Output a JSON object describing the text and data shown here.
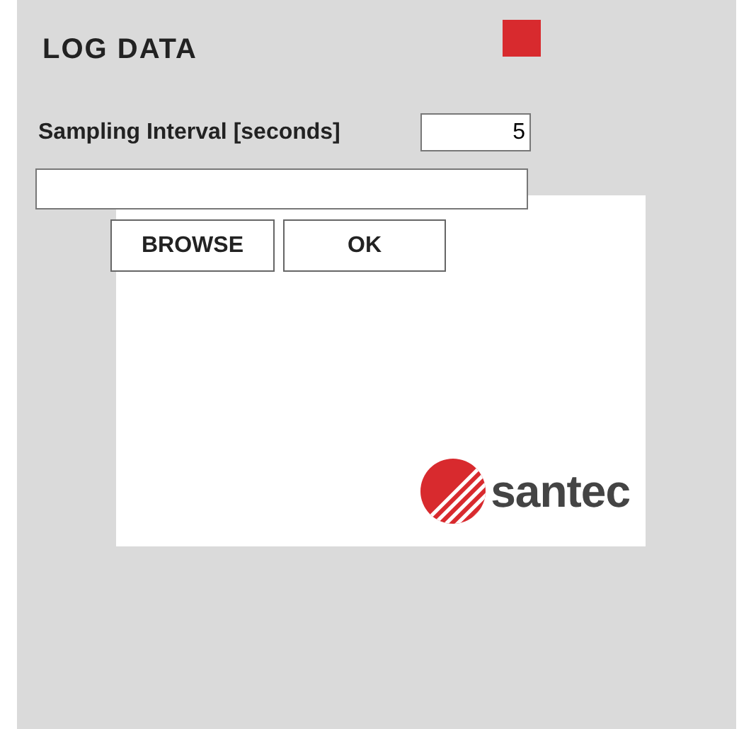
{
  "title": "LOG DATA",
  "sampling_interval": {
    "label": "Sampling Interval [seconds]",
    "value": "5"
  },
  "buttons": [
    "BROWSE",
    "OK"
  ],
  "logo": {
    "text": "santec"
  }
}
